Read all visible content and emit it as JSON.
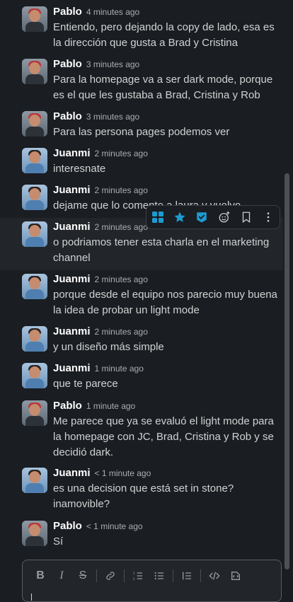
{
  "messages": [
    {
      "author": "Pablo",
      "time": "4 minutes ago",
      "text": "Entiendo, pero dejando la copy de lado, esa es la dirección que gusta a Brad y Cristina"
    },
    {
      "author": "Pablo",
      "time": "3 minutes ago",
      "text": "Para la homepage va a ser dark mode, porque es el que les gustaba a Brad, Cristina y Rob"
    },
    {
      "author": "Pablo",
      "time": "3 minutes ago",
      "text": "Para las persona pages podemos ver"
    },
    {
      "author": "Juanmi",
      "time": "2 minutes ago",
      "text": "interesnate"
    },
    {
      "author": "Juanmi",
      "time": "2 minutes ago",
      "text": "dejame que lo comente a laura y vuelvo"
    },
    {
      "author": "Juanmi",
      "time": "2 minutes ago",
      "text": "o podriamos tener esta charla en el marketing channel"
    },
    {
      "author": "Juanmi",
      "time": "2 minutes ago",
      "text": "porque desde el equipo nos parecio muy buena la idea de probar un light mode"
    },
    {
      "author": "Juanmi",
      "time": "2 minutes ago",
      "text": "y un diseño más simple"
    },
    {
      "author": "Juanmi",
      "time": "1 minute ago",
      "text": "que te parece"
    },
    {
      "author": "Pablo",
      "time": "1 minute ago",
      "text": "Me parece que ya se evaluó el light mode para la homepage con JC, Brad, Cristina y Rob y se decidió dark."
    },
    {
      "author": "Juanmi",
      "time": "< 1 minute ago",
      "text": "es una decision que está set in stone? inamovible?"
    },
    {
      "author": "Pablo",
      "time": "< 1 minute ago",
      "text": "Sí"
    }
  ],
  "hover_toolbar": {
    "icons": [
      "reaction-quick-icon",
      "star-icon",
      "check-icon",
      "add-reaction-icon",
      "bookmark-icon",
      "more-vertical-icon"
    ]
  },
  "composer": {
    "format_buttons": [
      "bold-icon",
      "italic-icon",
      "strikethrough-icon",
      "link-icon",
      "ordered-list-icon",
      "bulleted-list-icon",
      "blockquote-icon",
      "code-icon",
      "code-block-icon"
    ]
  },
  "colors": {
    "background": "#1a1d21",
    "accent": "#1d9bd1",
    "text": "#d1d2d3"
  }
}
